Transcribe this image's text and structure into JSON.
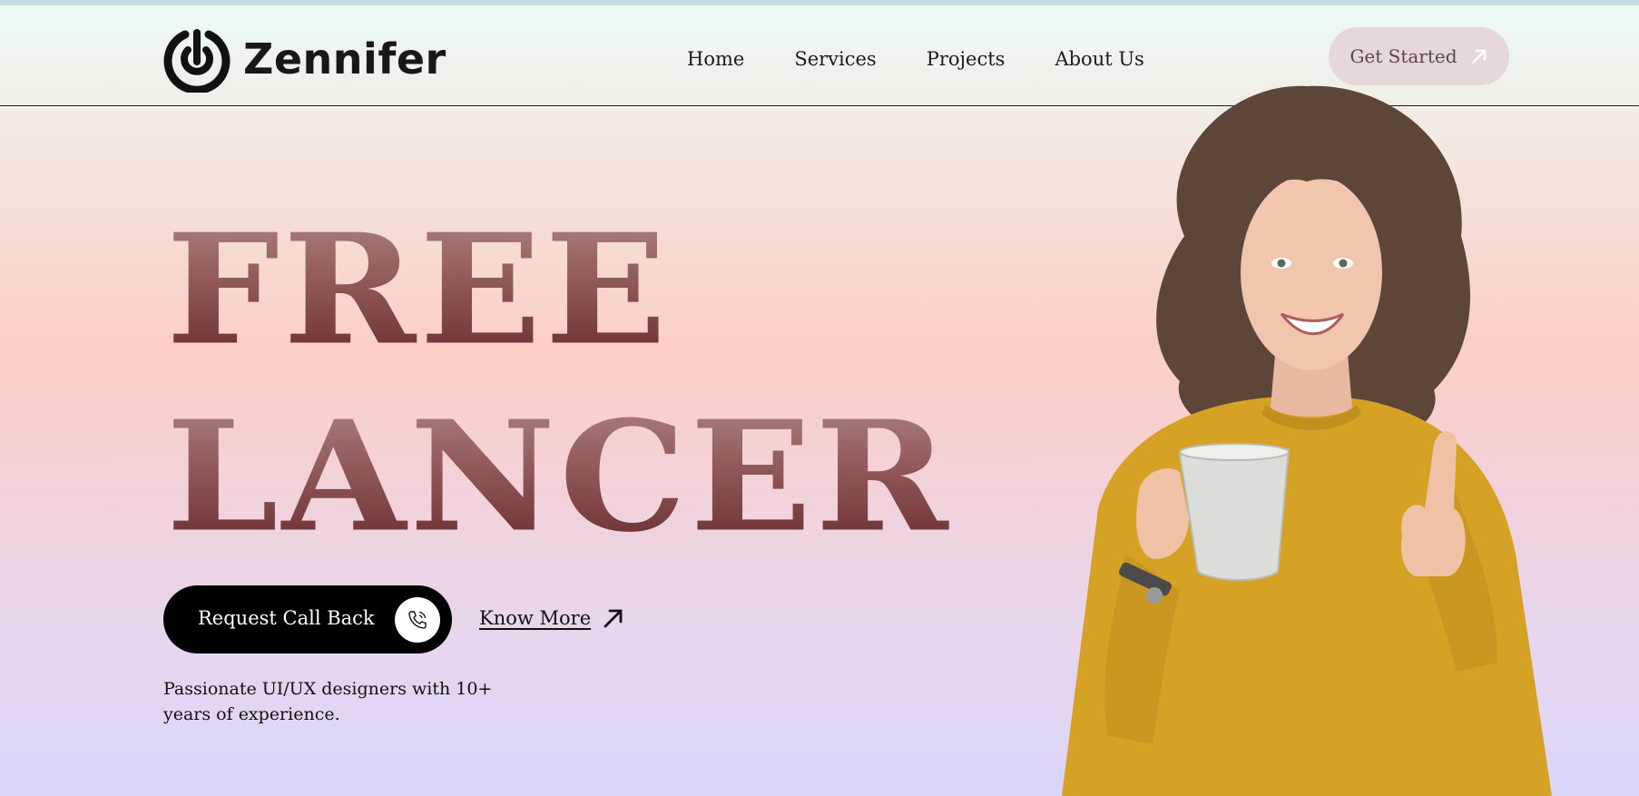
{
  "brand": {
    "name": "Zennifer"
  },
  "nav": {
    "items": [
      "Home",
      "Services",
      "Projects",
      "About Us"
    ]
  },
  "header": {
    "cta_label": "Get Started"
  },
  "hero": {
    "line1": "FREE",
    "line2": "LANCER",
    "primary_button_label": "Request Call Back",
    "secondary_link_label": "Know More",
    "description": "Passionate UI/UX designers with 10+ years of experience."
  },
  "colors": {
    "headline": "#8f5859",
    "cta_bg": "#e6d8d9",
    "primary_btn_bg": "#000000",
    "sweater": "#d6a226"
  },
  "icons": {
    "logo": "target-logo-icon",
    "cta": "arrow-up-right-icon",
    "call": "phone-call-icon",
    "know_more": "arrow-up-right-icon"
  }
}
